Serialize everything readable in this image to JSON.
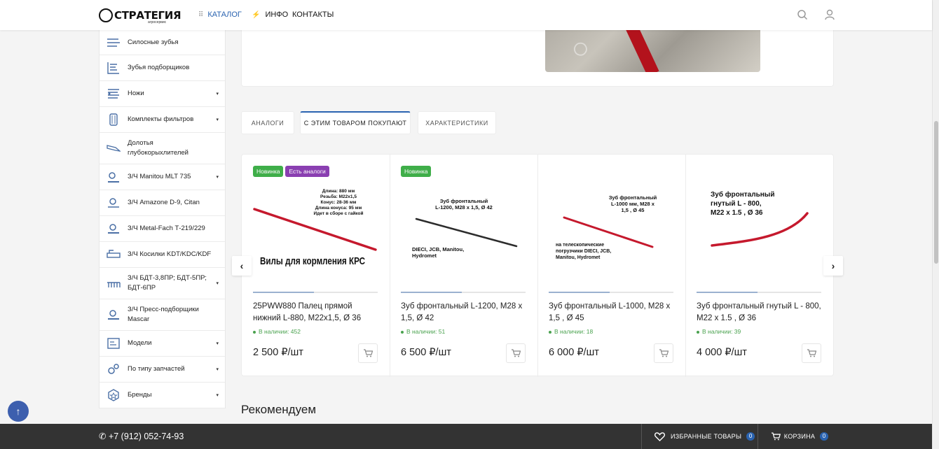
{
  "header": {
    "logo_text": "СТРАТЕГИЯ",
    "logo_sub": "агросервис",
    "nav": [
      {
        "label": "Каталог",
        "icon": "grid-icon"
      },
      {
        "label": "Инфо",
        "icon": "lightning-icon"
      },
      {
        "label": "Контакты"
      }
    ],
    "search_icon": "search-icon",
    "user_icon": "user-icon"
  },
  "sidebar": {
    "items": [
      {
        "label": "Силосные зубья",
        "icon": "silage-teeth-icon",
        "has_submenu": false
      },
      {
        "label": "Зубья подборщиков",
        "icon": "pickup-teeth-icon",
        "has_submenu": false
      },
      {
        "label": "Ножи",
        "icon": "knives-icon",
        "has_submenu": true
      },
      {
        "label": "Комплекты фильтров",
        "icon": "filter-icon",
        "has_submenu": true
      },
      {
        "label": "Долотья глубокорыхлителей",
        "icon": "chisel-icon",
        "has_submenu": false
      },
      {
        "label": "З/Ч Manitou MLT 735",
        "icon": "manitou-icon",
        "has_submenu": true
      },
      {
        "label": "З/Ч Amazone D-9, Citan",
        "icon": "amazone-icon",
        "has_submenu": false
      },
      {
        "label": "З/Ч Metal-Fach Т-219/229",
        "icon": "metal-fach-icon",
        "has_submenu": false
      },
      {
        "label": "З/Ч Косилки KDT/KDC/KDF",
        "icon": "mower-icon",
        "has_submenu": false
      },
      {
        "label": "З/Ч БДТ-3,8ПР; БДТ-5ПР; БДТ-6ПР",
        "icon": "harrow-icon",
        "has_submenu": true
      },
      {
        "label": "З/Ч Пресс-подборщики Mascar",
        "icon": "mascar-icon",
        "has_submenu": false
      },
      {
        "label": "Модели",
        "icon": "models-icon",
        "has_submenu": true
      },
      {
        "label": "По типу запчастей",
        "icon": "gears-icon",
        "has_submenu": true
      },
      {
        "label": "Бренды",
        "icon": "brand-badge-icon",
        "has_submenu": true
      }
    ]
  },
  "tabs": [
    {
      "label": "Аналоги",
      "active": false
    },
    {
      "label": "С этим товаром покупают",
      "active": true
    },
    {
      "label": "Характеристики",
      "active": false
    }
  ],
  "products": [
    {
      "badges": [
        "Новинка",
        "Есть аналоги"
      ],
      "name": "25PWW880 Палец прямой нижний L-880, M22х1,5, Ø 36",
      "stock": "В наличии: 452",
      "price": "2 500 ₽/шт",
      "img_title": "Вилы для кормления КРС",
      "img_specs": [
        "Длина: 880 мм",
        "Резьба: M22x1,5",
        "Конус: 28-36 мм",
        "Длина конуса: 95 мм",
        "Идет в сборе с гайкой"
      ]
    },
    {
      "badges": [
        "Новинка"
      ],
      "name": "Зуб фронтальный L-1200, M28 x 1,5, Ø 42",
      "stock": "В наличии: 51",
      "price": "6 500 ₽/шт",
      "img_lines": [
        "Зуб фронтальный",
        "L-1200, M28 x 1,5, Ø 42"
      ],
      "img_footer": [
        "DIECI, JCB, Manitou,",
        "Hydromet"
      ]
    },
    {
      "badges": [],
      "name": "Зуб фронтальный L-1000, M28 x 1,5 , Ø 45",
      "stock": "В наличии: 18",
      "price": "6 000 ₽/шт",
      "img_lines": [
        "Зуб фронтальный",
        "L-1000 мм, M28 x",
        "1,5 , Ø 45"
      ],
      "img_footer": [
        "на телескопические",
        "погрузчики DIECI, JCB,",
        "Manitou, Hydromet"
      ]
    },
    {
      "badges": [],
      "name": "Зуб фронтальный гнутый L - 800, M22 x 1.5 , Ø 36",
      "stock": "В наличии: 39",
      "price": "4 000 ₽/шт",
      "img_lines": [
        "Зуб фронтальный",
        "гнутый L - 800,",
        "M22 x 1.5 , Ø 36"
      ]
    }
  ],
  "recommend_title": "Рекомендуем",
  "footer": {
    "phone": "+7 (912) 052-74-93",
    "favorites_label": "Избранные товары",
    "favorites_count": "0",
    "cart_label": "Корзина",
    "cart_count": "0"
  },
  "colors": {
    "accent": "#2a63b0",
    "new_badge": "#3fae49",
    "analog_badge": "#8a3fb1",
    "stock_green": "#4aa24f",
    "footer_bg": "#333333",
    "product_red": "#c5192d"
  }
}
